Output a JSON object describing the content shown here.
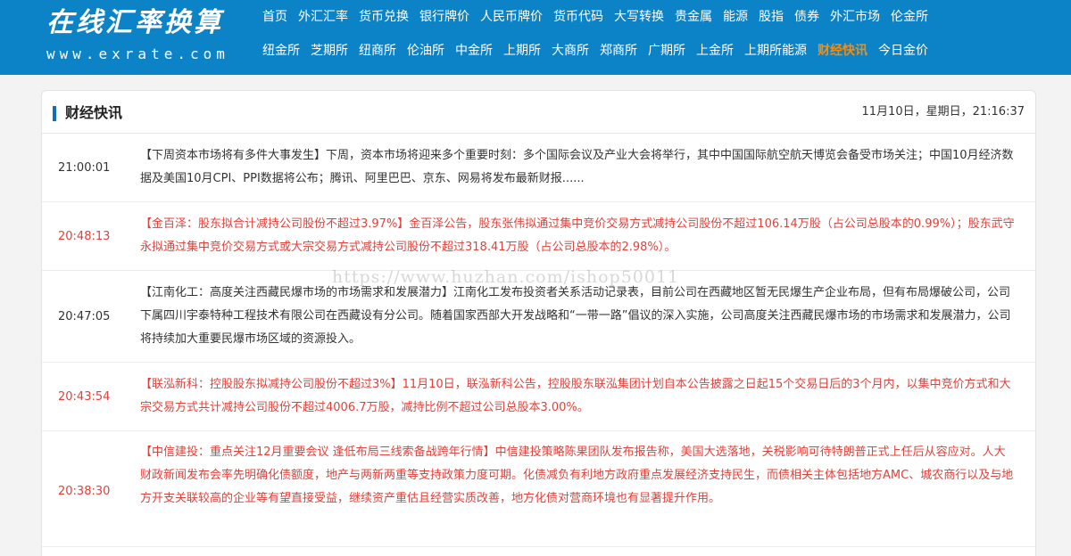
{
  "header": {
    "logo_cn": "在线汇率换算",
    "logo_en": "www.exrate.com",
    "nav_row1": [
      "首页",
      "外汇汇率",
      "货币兑换",
      "银行牌价",
      "人民币牌价",
      "货币代码",
      "大写转换",
      "贵金属",
      "能源",
      "股指",
      "债券",
      "外汇市场",
      "伦金所"
    ],
    "nav_row2": [
      "纽金所",
      "芝期所",
      "纽商所",
      "伦油所",
      "中金所",
      "上期所",
      "大商所",
      "郑商所",
      "广期所",
      "上金所",
      "上期所能源",
      "财经快讯",
      "今日金价"
    ],
    "active_nav": "财经快讯",
    "accent_color": "#0d83c7",
    "active_color": "#ff8a00"
  },
  "panel": {
    "title": "财经快讯",
    "date": "11月10日，星期日，21:16:37"
  },
  "news": [
    {
      "time": "21:00:01",
      "text": "【下周资本市场将有多件大事发生】下周，资本市场将迎来多个重要时刻：多个国际会议及产业大会将举行，其中中国国际航空航天博览会备受市场关注；中国10月经济数据及美国10月CPI、PPI数据将公布；腾讯、阿里巴巴、京东、网易将发布最新财报......",
      "important": false
    },
    {
      "time": "20:48:13",
      "text": "【金百泽：股东拟合计减持公司股份不超过3.97%】金百泽公告，股东张伟拟通过集中竞价交易方式减持公司股份不超过106.14万股（占公司总股本的0.99%）；股东武守永拟通过集中竞价交易方式或大宗交易方式减持公司股份不超过318.41万股（占公司总股本的2.98%）。",
      "important": true
    },
    {
      "time": "20:47:05",
      "text": "【江南化工：高度关注西藏民爆市场的市场需求和发展潜力】江南化工发布投资者关系活动记录表，目前公司在西藏地区暂无民爆生产企业布局，但有布局爆破公司，公司下属四川宇泰特种工程技术有限公司在西藏设有分公司。随着国家西部大开发战略和“一带一路”倡议的深入实施，公司高度关注西藏民爆市场的市场需求和发展潜力，公司将持续加大重要民爆市场区域的资源投入。",
      "important": false
    },
    {
      "time": "20:43:54",
      "text": "【联泓新科：控股股东拟减持公司股份不超过3%】11月10日，联泓新科公告，控股股东联泓集团计划自本公告披露之日起15个交易日后的3个月内，以集中竞价方式和大宗交易方式共计减持公司股份不超过4006.7万股，减持比例不超过公司总股本3.00%。",
      "important": true
    },
    {
      "time": "20:38:30",
      "text": "【中信建投：重点关注12月重要会议 逢低布局三线索备战跨年行情】中信建投策略陈果团队发布报告称，美国大选落地，关税影响可待特朗普正式上任后从容应对。人大财政新闻发布会率先明确化债额度，地产与两新两重等支持政策力度可期。化债减负有利地方政府重点发展经济支持民生，而债相关主体包括地方AMC、城农商行以及与地方开支关联较高的企业等有望直接受益，继续资产重估且经营实质改善，地方化债对营商环境也有显著提升作用。",
      "important": true
    }
  ],
  "watermark": "https://www.huzhan.com/ishop50011",
  "colors": {
    "important_text": "#e0413a",
    "normal_text": "#333333",
    "title_bar": "#0d6fc0"
  }
}
